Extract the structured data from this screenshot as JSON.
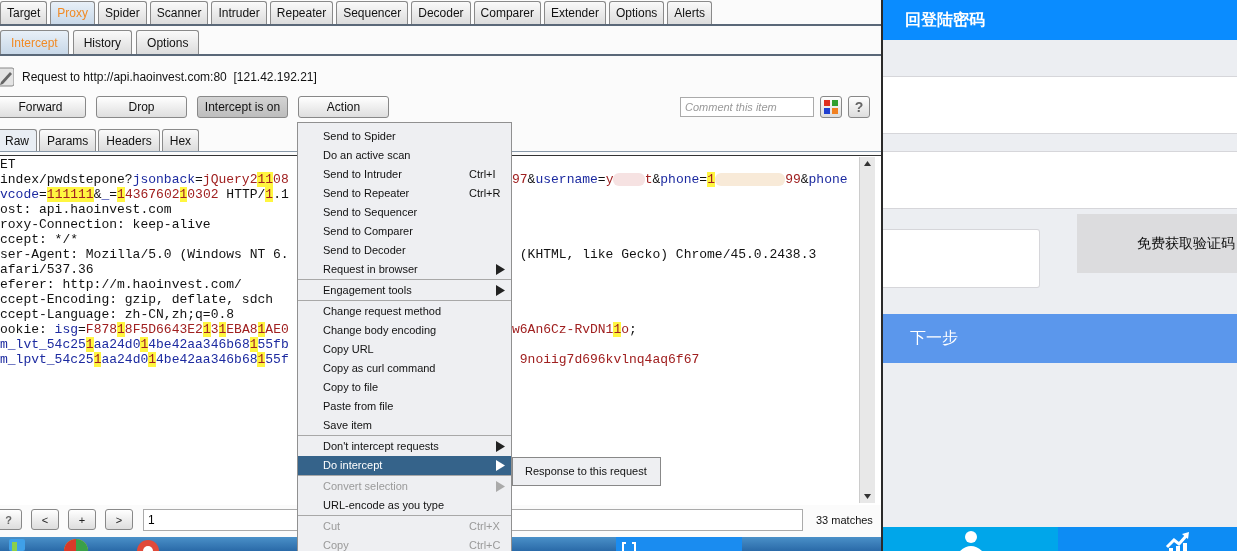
{
  "burp": {
    "tabs": [
      {
        "label": "Target",
        "selected": false
      },
      {
        "label": "Proxy",
        "selected": true
      },
      {
        "label": "Spider",
        "selected": false
      },
      {
        "label": "Scanner",
        "selected": false
      },
      {
        "label": "Intruder",
        "selected": false
      },
      {
        "label": "Repeater",
        "selected": false
      },
      {
        "label": "Sequencer",
        "selected": false
      },
      {
        "label": "Decoder",
        "selected": false
      },
      {
        "label": "Comparer",
        "selected": false
      },
      {
        "label": "Extender",
        "selected": false
      },
      {
        "label": "Options",
        "selected": false
      },
      {
        "label": "Alerts",
        "selected": false
      }
    ],
    "subtabs": [
      {
        "label": "Intercept",
        "selected": true
      },
      {
        "label": "History",
        "selected": false
      },
      {
        "label": "Options",
        "selected": false
      }
    ],
    "request_label": "Request to http://api.haoinvest.com:80  [121.42.192.21]",
    "buttons": [
      {
        "label": "Forward",
        "on": false
      },
      {
        "label": "Drop",
        "on": false
      },
      {
        "label": "Intercept is on",
        "on": true
      },
      {
        "label": "Action",
        "on": false
      }
    ],
    "comment": {
      "placeholder": "Comment this item"
    },
    "help": "?",
    "editor_tabs": [
      {
        "label": "Raw",
        "selected": true
      },
      {
        "label": "Params",
        "selected": false
      },
      {
        "label": "Headers",
        "selected": false
      },
      {
        "label": "Hex",
        "selected": false
      }
    ],
    "lines": [
      {
        "left": [
          {
            "text": "ET",
            "kind": "plain"
          }
        ]
      },
      {
        "left": [
          {
            "text": "index/pwdstepone?",
            "kind": "plain"
          },
          {
            "text": "jsonback",
            "kind": "name"
          },
          {
            "text": "=",
            "kind": "plain"
          },
          {
            "text": "jQuery2",
            "kind": "value"
          },
          {
            "text": "11",
            "kind": "mark"
          },
          {
            "text": "08",
            "kind": "value"
          }
        ],
        "right": [
          {
            "text": "97",
            "kind": "value"
          },
          {
            "text": "&",
            "kind": "plain"
          },
          {
            "text": "username",
            "kind": "name"
          },
          {
            "text": "=",
            "kind": "plain"
          },
          {
            "text": "y",
            "kind": "value"
          },
          {
            "kind": "blur"
          },
          {
            "text": "t",
            "kind": "value"
          },
          {
            "text": "&",
            "kind": "plain"
          },
          {
            "text": "phone",
            "kind": "name"
          },
          {
            "text": "=",
            "kind": "plain"
          },
          {
            "text": "1",
            "kind": "mark"
          },
          {
            "kind": "blur-wide"
          },
          {
            "text": "99",
            "kind": "value"
          },
          {
            "text": "&",
            "kind": "plain"
          },
          {
            "text": "phone",
            "kind": "name"
          }
        ]
      },
      {
        "left": [
          {
            "text": "vcode",
            "kind": "name"
          },
          {
            "text": "=",
            "kind": "plain"
          },
          {
            "text": "111111",
            "kind": "mark"
          },
          {
            "text": "&",
            "kind": "plain"
          },
          {
            "text": "_",
            "kind": "name"
          },
          {
            "text": "=",
            "kind": "plain"
          },
          {
            "text": "1",
            "kind": "mark"
          },
          {
            "text": "4367602",
            "kind": "value"
          },
          {
            "text": "1",
            "kind": "mark"
          },
          {
            "text": "0302",
            "kind": "value"
          },
          {
            "text": " HTTP/",
            "kind": "plain"
          },
          {
            "text": "1",
            "kind": "mark"
          },
          {
            "text": ".1",
            "kind": "plain"
          }
        ]
      },
      {
        "left": [
          {
            "text": "ost: api.haoinvest.com",
            "kind": "plain"
          }
        ]
      },
      {
        "left": [
          {
            "text": "roxy-Connection: keep-alive",
            "kind": "plain"
          }
        ]
      },
      {
        "left": [
          {
            "text": "ccept: */*",
            "kind": "plain"
          }
        ]
      },
      {
        "left": [
          {
            "text": "ser-Agent: Mozilla/5.0 (Windows NT 6.",
            "kind": "plain"
          }
        ],
        "right": [
          {
            "text": " (KHTML, like Gecko) Chrome/45.0.2438.3",
            "kind": "plain"
          }
        ]
      },
      {
        "left": [
          {
            "text": "afari/537.36",
            "kind": "plain"
          }
        ]
      },
      {
        "left": [
          {
            "text": "eferer: http://m.haoinvest.com/",
            "kind": "plain"
          }
        ]
      },
      {
        "left": [
          {
            "text": "ccept-Encoding: gzip, deflate, sdch",
            "kind": "plain"
          }
        ]
      },
      {
        "left": [
          {
            "text": "ccept-Language: zh-CN,zh;q=0.8",
            "kind": "plain"
          }
        ]
      },
      {
        "left": [
          {
            "text": "ookie: ",
            "kind": "plain"
          },
          {
            "text": "isg",
            "kind": "name"
          },
          {
            "text": "=",
            "kind": "plain"
          },
          {
            "text": "F878",
            "kind": "value"
          },
          {
            "text": "1",
            "kind": "mark"
          },
          {
            "text": "8F5D6643E2",
            "kind": "value"
          },
          {
            "text": "1",
            "kind": "mark"
          },
          {
            "text": "3",
            "kind": "value"
          },
          {
            "text": "1",
            "kind": "mark"
          },
          {
            "text": "EBA8",
            "kind": "value"
          },
          {
            "text": "1",
            "kind": "mark"
          },
          {
            "text": "AE0",
            "kind": "value"
          }
        ],
        "right": [
          {
            "text": "w6An6Cz-RvDN1",
            "kind": "value"
          },
          {
            "text": "1",
            "kind": "mark"
          },
          {
            "text": "o",
            "kind": "value"
          },
          {
            "text": ";",
            "kind": "plain"
          }
        ]
      },
      {
        "left": [
          {
            "text": "m_lvt_54c25",
            "kind": "name"
          },
          {
            "text": "1",
            "kind": "mark"
          },
          {
            "text": "aa24d0",
            "kind": "name"
          },
          {
            "text": "1",
            "kind": "mark"
          },
          {
            "text": "4be42aa346b68",
            "kind": "name"
          },
          {
            "text": "1",
            "kind": "mark"
          },
          {
            "text": "55fb",
            "kind": "name"
          }
        ]
      },
      {
        "left": [
          {
            "text": "m_lpvt_54c25",
            "kind": "name"
          },
          {
            "text": "1",
            "kind": "mark"
          },
          {
            "text": "aa24d0",
            "kind": "name"
          },
          {
            "text": "1",
            "kind": "mark"
          },
          {
            "text": "4be42aa346b68",
            "kind": "name"
          },
          {
            "text": "1",
            "kind": "mark"
          },
          {
            "text": "55f",
            "kind": "name"
          }
        ],
        "right": [
          {
            "text": " 9noiig7d696kvlnq4aq6f67",
            "kind": "value"
          }
        ]
      }
    ],
    "search": {
      "buttons": [
        "?",
        "<",
        "+",
        ">"
      ],
      "value": "1",
      "matches": "33 matches"
    }
  },
  "context_menu": {
    "groups": [
      [
        {
          "label": "Send to Spider",
          "selected": false,
          "disabled": false,
          "submenu": false
        },
        {
          "label": "Do an active scan",
          "selected": false,
          "disabled": false,
          "submenu": false
        },
        {
          "label": "Send to Intruder",
          "shortcut": "Ctrl+I",
          "selected": false,
          "disabled": false,
          "submenu": false
        },
        {
          "label": "Send to Repeater",
          "shortcut": "Ctrl+R",
          "selected": false,
          "disabled": false,
          "submenu": false
        },
        {
          "label": "Send to Sequencer",
          "selected": false,
          "disabled": false,
          "submenu": false
        },
        {
          "label": "Send to Comparer",
          "selected": false,
          "disabled": false,
          "submenu": false
        },
        {
          "label": "Send to Decoder",
          "selected": false,
          "disabled": false,
          "submenu": false
        },
        {
          "label": "Request in browser",
          "selected": false,
          "disabled": false,
          "submenu": true
        }
      ],
      [
        {
          "label": "Engagement tools",
          "selected": false,
          "disabled": false,
          "submenu": true
        }
      ],
      [
        {
          "label": "Change request method",
          "selected": false,
          "disabled": false,
          "submenu": false
        },
        {
          "label": "Change body encoding",
          "selected": false,
          "disabled": false,
          "submenu": false
        },
        {
          "label": "Copy URL",
          "selected": false,
          "disabled": false,
          "submenu": false
        },
        {
          "label": "Copy as curl command",
          "selected": false,
          "disabled": false,
          "submenu": false
        },
        {
          "label": "Copy to file",
          "selected": false,
          "disabled": false,
          "submenu": false
        },
        {
          "label": "Paste from file",
          "selected": false,
          "disabled": false,
          "submenu": false
        },
        {
          "label": "Save item",
          "selected": false,
          "disabled": false,
          "submenu": false
        }
      ],
      [
        {
          "label": "Don't intercept requests",
          "selected": false,
          "disabled": false,
          "submenu": true
        },
        {
          "label": "Do intercept",
          "selected": true,
          "disabled": false,
          "submenu": true
        }
      ],
      [
        {
          "label": "Convert selection",
          "selected": false,
          "disabled": true,
          "submenu": true
        },
        {
          "label": "URL-encode as you type",
          "selected": false,
          "disabled": false,
          "submenu": false
        }
      ],
      [
        {
          "label": "Cut",
          "shortcut": "Ctrl+X",
          "selected": false,
          "disabled": true,
          "submenu": false
        },
        {
          "label": "Copy",
          "shortcut": "Ctrl+C",
          "selected": false,
          "disabled": true,
          "submenu": false
        }
      ]
    ]
  },
  "submenu": {
    "items": [
      "Response to this request"
    ]
  },
  "mobile": {
    "title": "回登陆密码",
    "code_button": "免费获取验证码",
    "next_button": "下一步"
  }
}
